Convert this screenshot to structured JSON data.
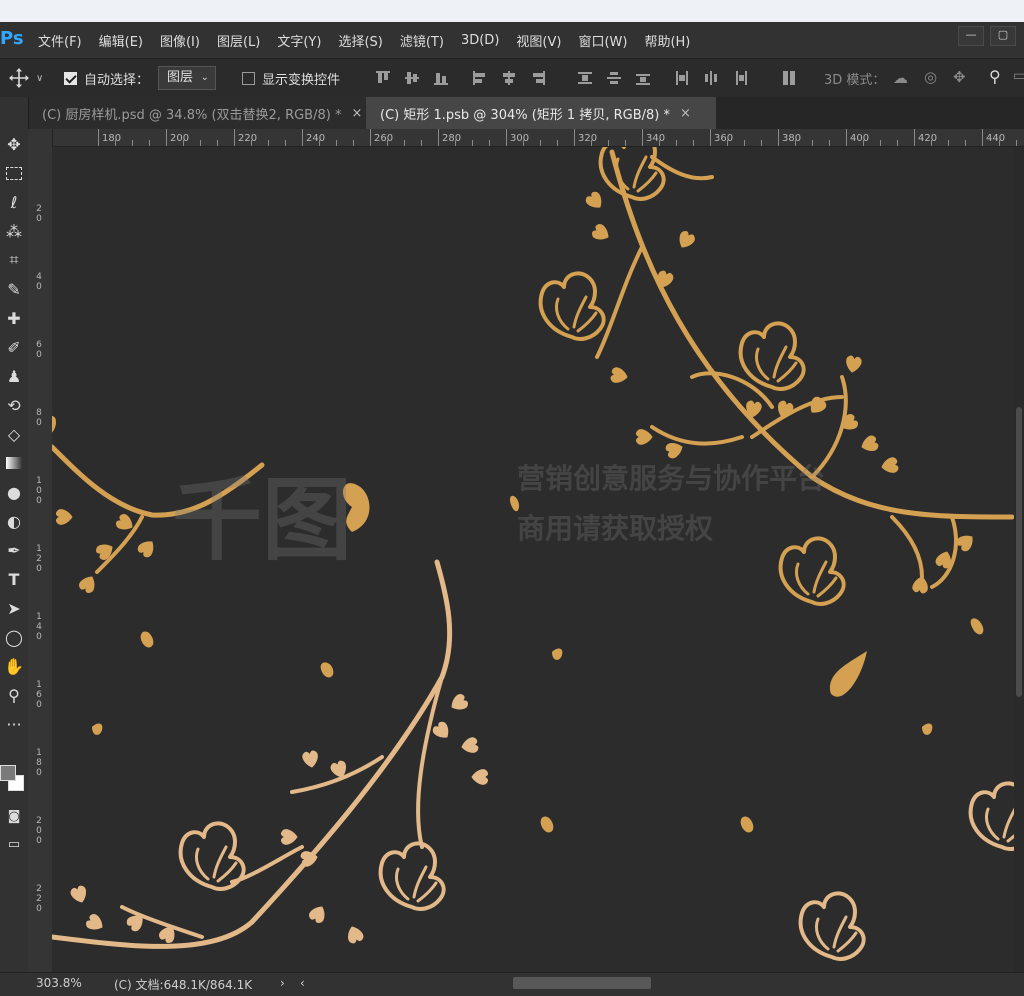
{
  "app": {
    "logo": "Ps"
  },
  "menu": [
    "文件(F)",
    "编辑(E)",
    "图像(I)",
    "图层(L)",
    "文字(Y)",
    "选择(S)",
    "滤镜(T)",
    "3D(D)",
    "视图(V)",
    "窗口(W)",
    "帮助(H)"
  ],
  "window_controls": {
    "minimize": "—",
    "restore": "▢"
  },
  "options": {
    "auto_select_label": "自动选择：",
    "auto_select_checked": true,
    "auto_select_value": "图层",
    "show_transform_label": "显示变换控件",
    "show_transform_checked": false,
    "mode_3d_label": "3D 模式："
  },
  "tabs": [
    {
      "label": "(C) 厨房样机.psd @ 34.8% (双击替换2, RGB/8) *",
      "active": false,
      "close": "×"
    },
    {
      "label": "(C) 矩形 1.psb @ 304% (矩形 1 拷贝, RGB/8) *",
      "active": true,
      "close": "×"
    }
  ],
  "ruler": {
    "top": [
      "180",
      "200",
      "220",
      "240",
      "260",
      "280",
      "300",
      "320",
      "340",
      "360",
      "380",
      "400",
      "420",
      "440"
    ],
    "left": [
      "20",
      "40",
      "60",
      "80",
      "100",
      "120",
      "140",
      "160",
      "180",
      "200",
      "220"
    ]
  },
  "watermark": {
    "logo": "千图",
    "line1": "营销创意服务与协作平台",
    "line2": "商用请获取授权"
  },
  "status": {
    "zoom": "303.8%",
    "doc": "(C) 文档:648.1K/864.1K"
  },
  "colors": {
    "ui_bg": "#323232",
    "canvas_bg": "#2c2c2c",
    "gold": "#d4a052",
    "tan": "#e3b98a",
    "ps_blue": "#31a8ff"
  }
}
